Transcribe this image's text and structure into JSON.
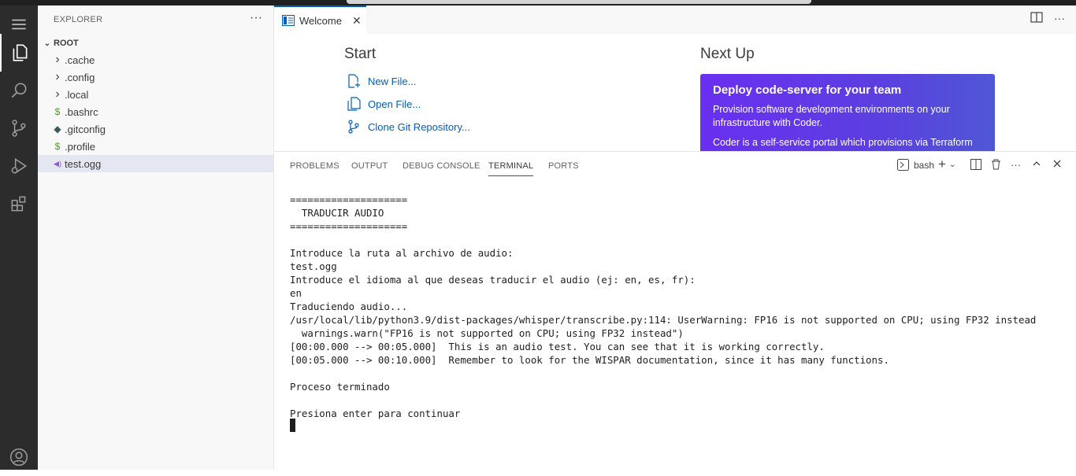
{
  "sidebar": {
    "title": "EXPLORER",
    "more": "···",
    "root_label": "ROOT",
    "items": [
      {
        "label": ".cache",
        "icon": "chevron-right-icon",
        "glyph": "›",
        "color": "#424242"
      },
      {
        "label": ".config",
        "icon": "chevron-right-icon",
        "glyph": "›",
        "color": "#424242"
      },
      {
        "label": ".local",
        "icon": "chevron-right-icon",
        "glyph": "›",
        "color": "#424242"
      },
      {
        "label": ".bashrc",
        "icon": "shell-file-icon",
        "glyph": "$",
        "color": "#4d9a2a"
      },
      {
        "label": ".gitconfig",
        "icon": "git-file-icon",
        "glyph": "◆",
        "color": "#41535b"
      },
      {
        "label": ".profile",
        "icon": "shell-file-icon",
        "glyph": "$",
        "color": "#4d9a2a"
      },
      {
        "label": "test.ogg",
        "icon": "audio-file-icon",
        "glyph": "◀)",
        "color": "#8a5cc7",
        "selected": true
      }
    ]
  },
  "editor": {
    "tab_label": "Welcome",
    "tab_close": "✕",
    "actions": [
      "split-editor-icon",
      "more-actions-icon"
    ]
  },
  "welcome": {
    "start_title": "Start",
    "links": [
      {
        "label": "New File...",
        "icon": "new-file-icon"
      },
      {
        "label": "Open File...",
        "icon": "open-file-icon"
      },
      {
        "label": "Clone Git Repository...",
        "icon": "source-control-icon"
      }
    ],
    "next_title": "Next Up",
    "card": {
      "title": "Deploy code-server for your team",
      "para1": "Provision software development environments on your infrastructure with Coder.",
      "para2": "Coder is a self-service portal which provisions via Terraform"
    }
  },
  "panel": {
    "tabs": [
      "PROBLEMS",
      "OUTPUT",
      "DEBUG CONSOLE",
      "TERMINAL",
      "PORTS"
    ],
    "active_tab": "TERMINAL",
    "shell_label": "bash"
  },
  "terminal": {
    "lines": [
      "====================",
      "  TRADUCIR AUDIO",
      "====================",
      "",
      "Introduce la ruta al archivo de audio:",
      "test.ogg",
      "Introduce el idioma al que deseas traducir el audio (ej: en, es, fr):",
      "en",
      "Traduciendo audio...",
      "/usr/local/lib/python3.9/dist-packages/whisper/transcribe.py:114: UserWarning: FP16 is not supported on CPU; using FP32 instead",
      "  warnings.warn(\"FP16 is not supported on CPU; using FP32 instead\")",
      "[00:00.000 --> 00:05.000]  This is an audio test. You can see that it is working correctly.",
      "[00:05.000 --> 00:10.000]  Remember to look for the WISPAR documentation, since it has many functions.",
      "",
      "Proceso terminado",
      "",
      "Presiona enter para continuar"
    ]
  },
  "colors": {
    "accent": "#005fb8",
    "activity_bg": "#2c2c2c",
    "sidebar_bg": "#f8f8f8",
    "selected": "#e4e6f1"
  }
}
